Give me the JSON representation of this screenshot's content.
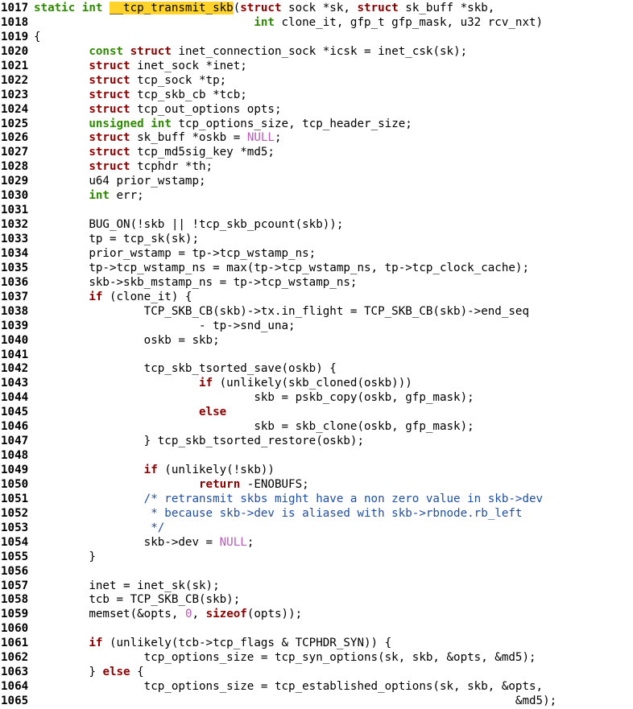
{
  "editor": {
    "lines": [
      {
        "n": "1017",
        "i": 0,
        "p": [
          [
            "sc",
            "static"
          ],
          [
            "t",
            " "
          ],
          [
            "ty",
            "int"
          ],
          [
            "t",
            " "
          ],
          [
            "hl",
            "__tcp_transmit_skb"
          ],
          [
            "t",
            "("
          ],
          [
            "kw",
            "struct"
          ],
          [
            "t",
            " sock *sk, "
          ],
          [
            "kw",
            "struct"
          ],
          [
            "t",
            " sk_buff *skb,"
          ]
        ]
      },
      {
        "n": "1018",
        "i": 0,
        "p": [
          [
            "t",
            "                                "
          ],
          [
            "ty",
            "int"
          ],
          [
            "t",
            " clone_it, gfp_t gfp_mask, u32 rcv_nxt)"
          ]
        ]
      },
      {
        "n": "1019",
        "i": 0,
        "p": [
          [
            "t",
            "{"
          ]
        ]
      },
      {
        "n": "1020",
        "i": 1,
        "p": [
          [
            "ty",
            "const"
          ],
          [
            "t",
            " "
          ],
          [
            "kw",
            "struct"
          ],
          [
            "t",
            " inet_connection_sock *icsk = inet_csk(sk);"
          ]
        ]
      },
      {
        "n": "1021",
        "i": 1,
        "p": [
          [
            "kw",
            "struct"
          ],
          [
            "t",
            " inet_sock *inet;"
          ]
        ]
      },
      {
        "n": "1022",
        "i": 1,
        "p": [
          [
            "kw",
            "struct"
          ],
          [
            "t",
            " tcp_sock *tp;"
          ]
        ]
      },
      {
        "n": "1023",
        "i": 1,
        "p": [
          [
            "kw",
            "struct"
          ],
          [
            "t",
            " tcp_skb_cb *tcb;"
          ]
        ]
      },
      {
        "n": "1024",
        "i": 1,
        "p": [
          [
            "kw",
            "struct"
          ],
          [
            "t",
            " tcp_out_options opts;"
          ]
        ]
      },
      {
        "n": "1025",
        "i": 1,
        "p": [
          [
            "ty",
            "unsigned"
          ],
          [
            "t",
            " "
          ],
          [
            "ty",
            "int"
          ],
          [
            "t",
            " tcp_options_size, tcp_header_size;"
          ]
        ]
      },
      {
        "n": "1026",
        "i": 1,
        "p": [
          [
            "kw",
            "struct"
          ],
          [
            "t",
            " sk_buff *oskb = "
          ],
          [
            "cst",
            "NULL"
          ],
          [
            "t",
            ";"
          ]
        ]
      },
      {
        "n": "1027",
        "i": 1,
        "p": [
          [
            "kw",
            "struct"
          ],
          [
            "t",
            " tcp_md5sig_key *md5;"
          ]
        ]
      },
      {
        "n": "1028",
        "i": 1,
        "p": [
          [
            "kw",
            "struct"
          ],
          [
            "t",
            " tcphdr *th;"
          ]
        ]
      },
      {
        "n": "1029",
        "i": 1,
        "p": [
          [
            "t",
            "u64 prior_wstamp;"
          ]
        ]
      },
      {
        "n": "1030",
        "i": 1,
        "p": [
          [
            "ty",
            "int"
          ],
          [
            "t",
            " err;"
          ]
        ]
      },
      {
        "n": "1031",
        "i": 0,
        "p": []
      },
      {
        "n": "1032",
        "i": 1,
        "p": [
          [
            "t",
            "BUG_ON(!skb || !tcp_skb_pcount(skb));"
          ]
        ]
      },
      {
        "n": "1033",
        "i": 1,
        "p": [
          [
            "t",
            "tp = tcp_sk(sk);"
          ]
        ]
      },
      {
        "n": "1034",
        "i": 1,
        "p": [
          [
            "t",
            "prior_wstamp = tp->tcp_wstamp_ns;"
          ]
        ]
      },
      {
        "n": "1035",
        "i": 1,
        "p": [
          [
            "t",
            "tp->tcp_wstamp_ns = max(tp->tcp_wstamp_ns, tp->tcp_clock_cache);"
          ]
        ]
      },
      {
        "n": "1036",
        "i": 1,
        "p": [
          [
            "t",
            "skb->skb_mstamp_ns = tp->tcp_wstamp_ns;"
          ]
        ]
      },
      {
        "n": "1037",
        "i": 1,
        "p": [
          [
            "kw",
            "if"
          ],
          [
            "t",
            " (clone_it) {"
          ]
        ]
      },
      {
        "n": "1038",
        "i": 2,
        "p": [
          [
            "t",
            "TCP_SKB_CB(skb)->tx.in_flight = TCP_SKB_CB(skb)->end_seq"
          ]
        ]
      },
      {
        "n": "1039",
        "i": 3,
        "p": [
          [
            "t",
            "- tp->snd_una;"
          ]
        ]
      },
      {
        "n": "1040",
        "i": 2,
        "p": [
          [
            "t",
            "oskb = skb;"
          ]
        ]
      },
      {
        "n": "1041",
        "i": 0,
        "p": []
      },
      {
        "n": "1042",
        "i": 2,
        "p": [
          [
            "t",
            "tcp_skb_tsorted_save(oskb) {"
          ]
        ]
      },
      {
        "n": "1043",
        "i": 3,
        "p": [
          [
            "kw",
            "if"
          ],
          [
            "t",
            " (unlikely(skb_cloned(oskb)))"
          ]
        ]
      },
      {
        "n": "1044",
        "i": 4,
        "p": [
          [
            "t",
            "skb = pskb_copy(oskb, gfp_mask);"
          ]
        ]
      },
      {
        "n": "1045",
        "i": 3,
        "p": [
          [
            "kw",
            "else"
          ]
        ]
      },
      {
        "n": "1046",
        "i": 4,
        "p": [
          [
            "t",
            "skb = skb_clone(oskb, gfp_mask);"
          ]
        ]
      },
      {
        "n": "1047",
        "i": 2,
        "p": [
          [
            "t",
            "} tcp_skb_tsorted_restore(oskb);"
          ]
        ]
      },
      {
        "n": "1048",
        "i": 0,
        "p": []
      },
      {
        "n": "1049",
        "i": 2,
        "p": [
          [
            "kw",
            "if"
          ],
          [
            "t",
            " (unlikely(!skb))"
          ]
        ]
      },
      {
        "n": "1050",
        "i": 3,
        "p": [
          [
            "kw",
            "return"
          ],
          [
            "t",
            " -ENOBUFS;"
          ]
        ]
      },
      {
        "n": "1051",
        "i": 2,
        "p": [
          [
            "cm",
            "/* retransmit skbs might have a non zero value in skb->dev"
          ]
        ]
      },
      {
        "n": "1052",
        "i": 2,
        "p": [
          [
            "cm",
            " * because skb->dev is aliased with skb->rbnode.rb_left"
          ]
        ]
      },
      {
        "n": "1053",
        "i": 2,
        "p": [
          [
            "cm",
            " */"
          ]
        ]
      },
      {
        "n": "1054",
        "i": 2,
        "p": [
          [
            "t",
            "skb->dev = "
          ],
          [
            "cst",
            "NULL"
          ],
          [
            "t",
            ";"
          ]
        ]
      },
      {
        "n": "1055",
        "i": 1,
        "p": [
          [
            "t",
            "}"
          ]
        ]
      },
      {
        "n": "1056",
        "i": 0,
        "p": []
      },
      {
        "n": "1057",
        "i": 1,
        "p": [
          [
            "t",
            "inet = inet_sk(sk);"
          ]
        ]
      },
      {
        "n": "1058",
        "i": 1,
        "p": [
          [
            "t",
            "tcb = TCP_SKB_CB(skb);"
          ]
        ]
      },
      {
        "n": "1059",
        "i": 1,
        "p": [
          [
            "t",
            "memset(&opts, "
          ],
          [
            "cst",
            "0"
          ],
          [
            "t",
            ", "
          ],
          [
            "kw",
            "sizeof"
          ],
          [
            "t",
            "(opts));"
          ]
        ]
      },
      {
        "n": "1060",
        "i": 0,
        "p": []
      },
      {
        "n": "1061",
        "i": 1,
        "p": [
          [
            "kw",
            "if"
          ],
          [
            "t",
            " (unlikely(tcb->tcp_flags & TCPHDR_SYN)) {"
          ]
        ]
      },
      {
        "n": "1062",
        "i": 2,
        "p": [
          [
            "t",
            "tcp_options_size = tcp_syn_options(sk, skb, &opts, &md5);"
          ]
        ]
      },
      {
        "n": "1063",
        "i": 1,
        "p": [
          [
            "t",
            "} "
          ],
          [
            "kw",
            "else"
          ],
          [
            "t",
            " {"
          ]
        ]
      },
      {
        "n": "1064",
        "i": 2,
        "p": [
          [
            "t",
            "tcp_options_size = tcp_established_options(sk, skb, &opts,"
          ]
        ]
      },
      {
        "n": "1065",
        "i": 2,
        "p": [
          [
            "t",
            "                                                      &md5);"
          ]
        ]
      }
    ]
  },
  "colors": {
    "keyword": "#8b0000",
    "type": "#2e8b00",
    "constant": "#b85ab8",
    "comment": "#1f4fa0",
    "highlight": "#ffd32a"
  }
}
